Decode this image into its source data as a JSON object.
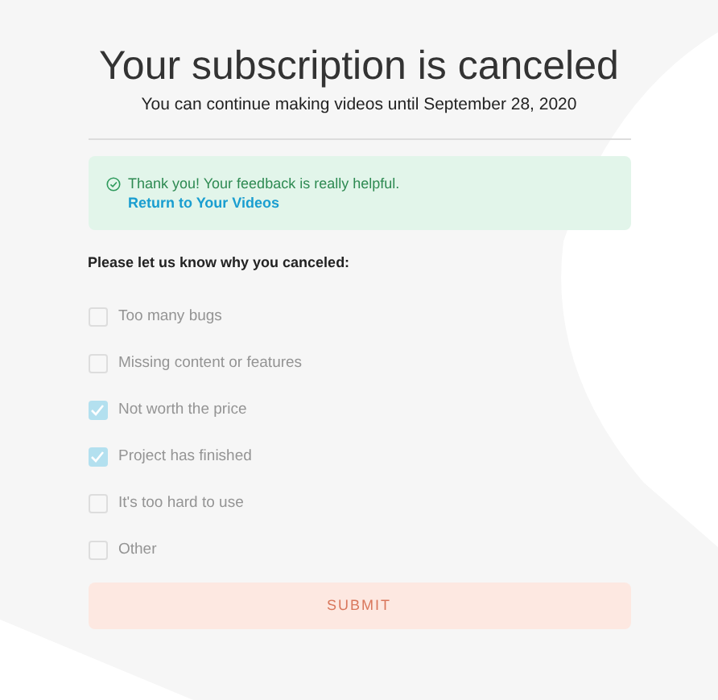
{
  "title": "Your subscription is canceled",
  "subtitle": "You can continue making videos until September 28, 2020",
  "notice": {
    "message": "Thank you! Your feedback is really helpful.",
    "link": "Return to Your Videos"
  },
  "question": "Please let us know why you canceled:",
  "reasons": [
    {
      "label": "Too many bugs",
      "checked": false
    },
    {
      "label": "Missing content or features",
      "checked": false
    },
    {
      "label": "Not worth the price",
      "checked": true
    },
    {
      "label": "Project has finished",
      "checked": true
    },
    {
      "label": "It's too hard to use",
      "checked": false
    },
    {
      "label": "Other",
      "checked": false
    }
  ],
  "submit": {
    "label": "SUBMIT",
    "disabled": true
  }
}
